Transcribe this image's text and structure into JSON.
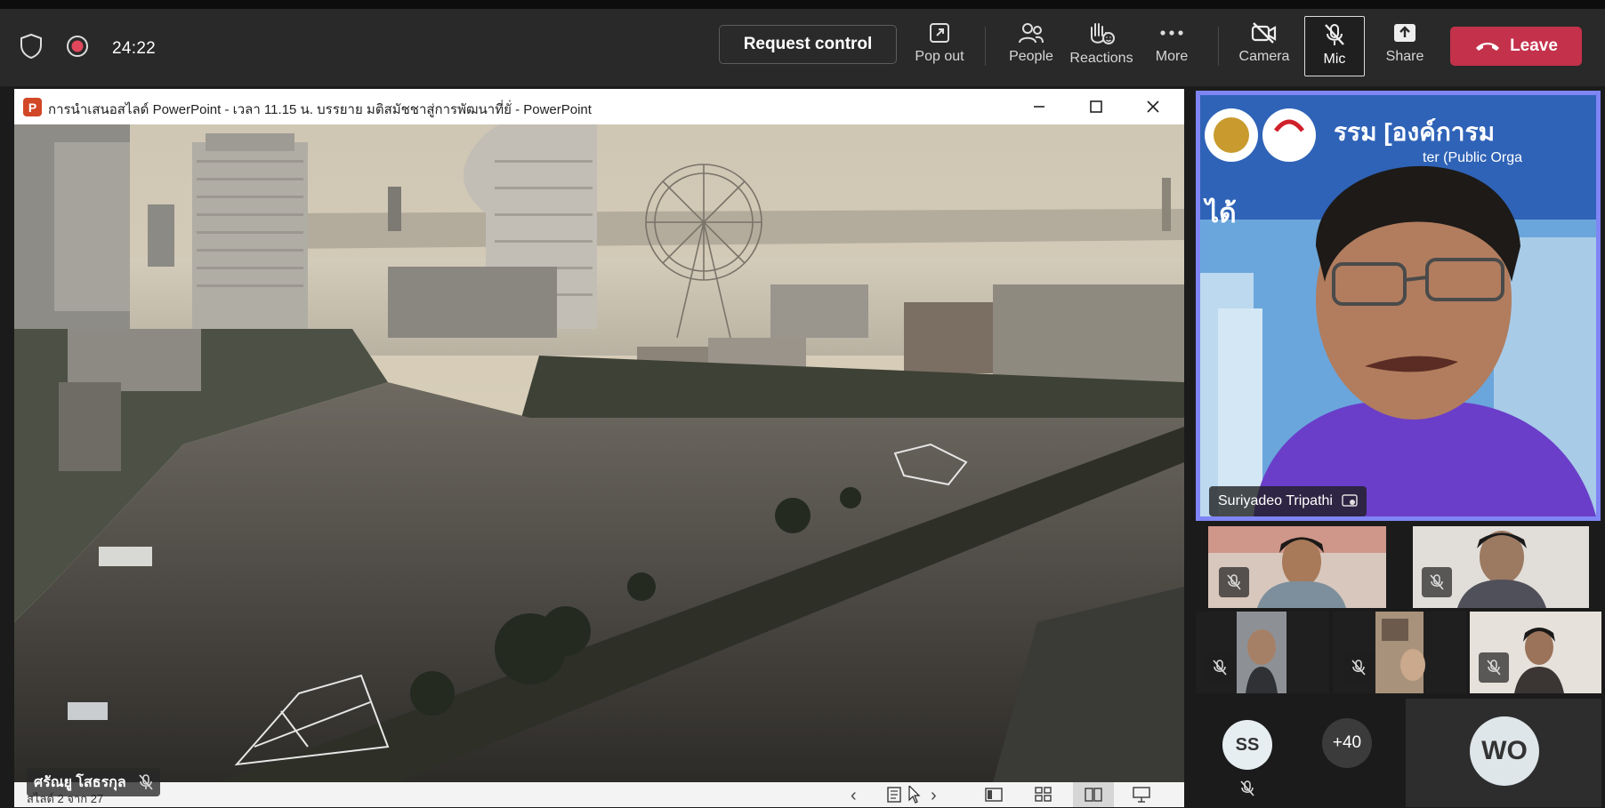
{
  "toolbar": {
    "timer": "24:22",
    "request_control": "Request control",
    "pop_out": "Pop out",
    "people": "People",
    "reactions": "Reactions",
    "more": "More",
    "camera": "Camera",
    "mic": "Mic",
    "share": "Share",
    "leave": "Leave",
    "leave_color": "#c4314b"
  },
  "presentation": {
    "window_title": "การนำเสนอสไลด์ PowerPoint  -  เวลา 11.15 น. บรรยาย มติสมัชชาสู่การพัฒนาที่ยั่ - PowerPoint",
    "app_icon_letter": "P",
    "presenter_name": "ศรัณยู โสธรกุล",
    "slide_counter": "สไลด์ 2 จาก 27"
  },
  "speaker": {
    "name": "Suriyadeo Tripathi",
    "highlight_color": "#7f85f5",
    "background_text_1": "รรม [องค์การม",
    "background_text_2": "ter (Public Orga",
    "background_text_3": "ได้"
  },
  "participants": {
    "overflow_count": "+40",
    "avatar_ss": "SS",
    "avatar_wo": "WO"
  }
}
